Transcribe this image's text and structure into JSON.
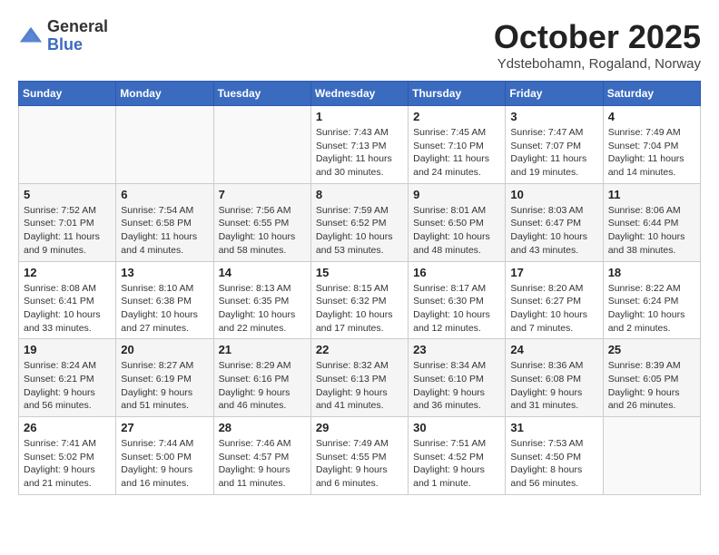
{
  "header": {
    "logo_general": "General",
    "logo_blue": "Blue",
    "month": "October 2025",
    "location": "Ydstebohamn, Rogaland, Norway"
  },
  "days_of_week": [
    "Sunday",
    "Monday",
    "Tuesday",
    "Wednesday",
    "Thursday",
    "Friday",
    "Saturday"
  ],
  "weeks": [
    [
      {
        "day": "",
        "info": ""
      },
      {
        "day": "",
        "info": ""
      },
      {
        "day": "",
        "info": ""
      },
      {
        "day": "1",
        "info": "Sunrise: 7:43 AM\nSunset: 7:13 PM\nDaylight: 11 hours\nand 30 minutes."
      },
      {
        "day": "2",
        "info": "Sunrise: 7:45 AM\nSunset: 7:10 PM\nDaylight: 11 hours\nand 24 minutes."
      },
      {
        "day": "3",
        "info": "Sunrise: 7:47 AM\nSunset: 7:07 PM\nDaylight: 11 hours\nand 19 minutes."
      },
      {
        "day": "4",
        "info": "Sunrise: 7:49 AM\nSunset: 7:04 PM\nDaylight: 11 hours\nand 14 minutes."
      }
    ],
    [
      {
        "day": "5",
        "info": "Sunrise: 7:52 AM\nSunset: 7:01 PM\nDaylight: 11 hours\nand 9 minutes."
      },
      {
        "day": "6",
        "info": "Sunrise: 7:54 AM\nSunset: 6:58 PM\nDaylight: 11 hours\nand 4 minutes."
      },
      {
        "day": "7",
        "info": "Sunrise: 7:56 AM\nSunset: 6:55 PM\nDaylight: 10 hours\nand 58 minutes."
      },
      {
        "day": "8",
        "info": "Sunrise: 7:59 AM\nSunset: 6:52 PM\nDaylight: 10 hours\nand 53 minutes."
      },
      {
        "day": "9",
        "info": "Sunrise: 8:01 AM\nSunset: 6:50 PM\nDaylight: 10 hours\nand 48 minutes."
      },
      {
        "day": "10",
        "info": "Sunrise: 8:03 AM\nSunset: 6:47 PM\nDaylight: 10 hours\nand 43 minutes."
      },
      {
        "day": "11",
        "info": "Sunrise: 8:06 AM\nSunset: 6:44 PM\nDaylight: 10 hours\nand 38 minutes."
      }
    ],
    [
      {
        "day": "12",
        "info": "Sunrise: 8:08 AM\nSunset: 6:41 PM\nDaylight: 10 hours\nand 33 minutes."
      },
      {
        "day": "13",
        "info": "Sunrise: 8:10 AM\nSunset: 6:38 PM\nDaylight: 10 hours\nand 27 minutes."
      },
      {
        "day": "14",
        "info": "Sunrise: 8:13 AM\nSunset: 6:35 PM\nDaylight: 10 hours\nand 22 minutes."
      },
      {
        "day": "15",
        "info": "Sunrise: 8:15 AM\nSunset: 6:32 PM\nDaylight: 10 hours\nand 17 minutes."
      },
      {
        "day": "16",
        "info": "Sunrise: 8:17 AM\nSunset: 6:30 PM\nDaylight: 10 hours\nand 12 minutes."
      },
      {
        "day": "17",
        "info": "Sunrise: 8:20 AM\nSunset: 6:27 PM\nDaylight: 10 hours\nand 7 minutes."
      },
      {
        "day": "18",
        "info": "Sunrise: 8:22 AM\nSunset: 6:24 PM\nDaylight: 10 hours\nand 2 minutes."
      }
    ],
    [
      {
        "day": "19",
        "info": "Sunrise: 8:24 AM\nSunset: 6:21 PM\nDaylight: 9 hours\nand 56 minutes."
      },
      {
        "day": "20",
        "info": "Sunrise: 8:27 AM\nSunset: 6:19 PM\nDaylight: 9 hours\nand 51 minutes."
      },
      {
        "day": "21",
        "info": "Sunrise: 8:29 AM\nSunset: 6:16 PM\nDaylight: 9 hours\nand 46 minutes."
      },
      {
        "day": "22",
        "info": "Sunrise: 8:32 AM\nSunset: 6:13 PM\nDaylight: 9 hours\nand 41 minutes."
      },
      {
        "day": "23",
        "info": "Sunrise: 8:34 AM\nSunset: 6:10 PM\nDaylight: 9 hours\nand 36 minutes."
      },
      {
        "day": "24",
        "info": "Sunrise: 8:36 AM\nSunset: 6:08 PM\nDaylight: 9 hours\nand 31 minutes."
      },
      {
        "day": "25",
        "info": "Sunrise: 8:39 AM\nSunset: 6:05 PM\nDaylight: 9 hours\nand 26 minutes."
      }
    ],
    [
      {
        "day": "26",
        "info": "Sunrise: 7:41 AM\nSunset: 5:02 PM\nDaylight: 9 hours\nand 21 minutes."
      },
      {
        "day": "27",
        "info": "Sunrise: 7:44 AM\nSunset: 5:00 PM\nDaylight: 9 hours\nand 16 minutes."
      },
      {
        "day": "28",
        "info": "Sunrise: 7:46 AM\nSunset: 4:57 PM\nDaylight: 9 hours\nand 11 minutes."
      },
      {
        "day": "29",
        "info": "Sunrise: 7:49 AM\nSunset: 4:55 PM\nDaylight: 9 hours\nand 6 minutes."
      },
      {
        "day": "30",
        "info": "Sunrise: 7:51 AM\nSunset: 4:52 PM\nDaylight: 9 hours\nand 1 minute."
      },
      {
        "day": "31",
        "info": "Sunrise: 7:53 AM\nSunset: 4:50 PM\nDaylight: 8 hours\nand 56 minutes."
      },
      {
        "day": "",
        "info": ""
      }
    ]
  ]
}
